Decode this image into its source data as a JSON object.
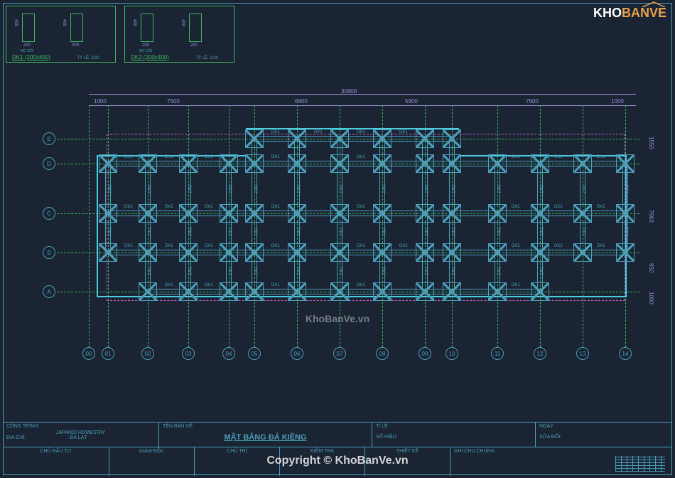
{
  "watermark": {
    "logo_part1": "KHO",
    "logo_part2": "BANVE",
    "center": "KhoBanVe.vn",
    "copyright": "Copyright © KhoBanVe.vn"
  },
  "details": {
    "dk1": {
      "label": "DK1 (200x400)",
      "scale": "TỶ LỆ: 1/20",
      "w": "200",
      "h": "400",
      "mc": "MC GỐI"
    },
    "dk2": {
      "label": "DK2 (200x400)",
      "scale": "TỶ LỆ: 1/20",
      "w": "200",
      "h": "400",
      "mc": "MC GỐI"
    }
  },
  "plan": {
    "total_width": "30900",
    "dims_top": [
      "1000",
      "7500",
      "6900",
      "5900",
      "7500",
      "1000"
    ],
    "dims_right": [
      "1000",
      "1550",
      "7660",
      "950"
    ],
    "row_labels": [
      "E",
      "D",
      "C",
      "B",
      "A"
    ],
    "col_labels": [
      "00",
      "01",
      "02",
      "03",
      "04",
      "05",
      "06",
      "07",
      "08",
      "09",
      "10",
      "11",
      "12",
      "13",
      "14"
    ],
    "beam_dk1": "DK1",
    "beam_dk2": "DK2"
  },
  "title_block": {
    "cong_trinh_label": "CÔNG TRÌNH:",
    "cong_trinh": "JAPANDI HOMESTAY",
    "dia_chi_label": "ĐỊA CHỈ:",
    "dia_chi": "ĐÀ LẠT",
    "ten_ban_ve_label": "TÊN BẢN VẼ:",
    "drawing_title": "MẶT BẰNG ĐÁ KIỀNG",
    "ti_le_label": "TỈ LỆ:",
    "so_hieu_label": "SỐ HIỆU:",
    "ngay_label": "NGÀY:",
    "sua_doi_label": "SỬA ĐỔI:",
    "chu_dau_tu": "CHỦ ĐẦU TƯ",
    "giam_doc": "GIÁM ĐỐC",
    "chu_tri": "CHỦ TRÌ",
    "kiem_tra": "KIỂM TRA",
    "thiet_ke": "THIẾT KẾ",
    "ghi_chu": "GHI CHÚ CHUNG"
  }
}
